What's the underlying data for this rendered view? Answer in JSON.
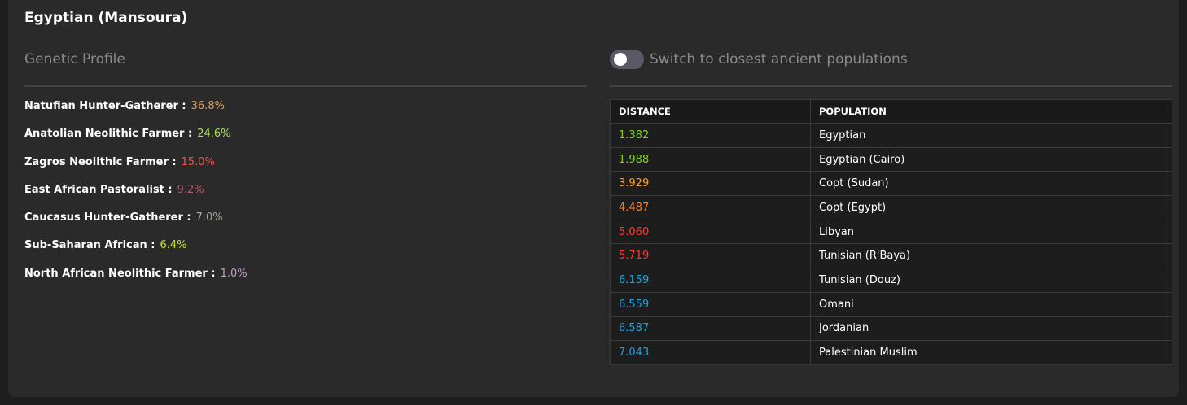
{
  "title": "Egyptian (Mansoura)",
  "genetic_profile": {
    "heading": "Genetic Profile",
    "items": [
      {
        "name": "Natufian Hunter-Gatherer :",
        "value": "36.8%",
        "color": "#d9a066"
      },
      {
        "name": "Anatolian Neolithic Farmer :",
        "value": "24.6%",
        "color": "#a5e05a"
      },
      {
        "name": "Zagros Neolithic Farmer :",
        "value": "15.0%",
        "color": "#ef5350"
      },
      {
        "name": "East African Pastoralist :",
        "value": "9.2%",
        "color": "#b5566c"
      },
      {
        "name": "Caucasus Hunter-Gatherer :",
        "value": "7.0%",
        "color": "#a8a89a"
      },
      {
        "name": "Sub-Saharan African :",
        "value": "6.4%",
        "color": "#c6e02a"
      },
      {
        "name": "North African Neolithic Farmer :",
        "value": "1.0%",
        "color": "#c49ac4"
      }
    ]
  },
  "toggle": {
    "label": "Switch to closest ancient populations",
    "on": false
  },
  "table": {
    "headers": {
      "distance": "DISTANCE",
      "population": "POPULATION"
    },
    "rows": [
      {
        "distance": "1.382",
        "population": "Egyptian",
        "color": "#7ed321"
      },
      {
        "distance": "1.988",
        "population": "Egyptian (Cairo)",
        "color": "#7ed321"
      },
      {
        "distance": "3.929",
        "population": "Copt (Sudan)",
        "color": "#ff9f1a"
      },
      {
        "distance": "4.487",
        "population": "Copt (Egypt)",
        "color": "#ff7a1a"
      },
      {
        "distance": "5.060",
        "population": "Libyan",
        "color": "#ff3b30"
      },
      {
        "distance": "5.719",
        "population": "Tunisian (R'Baya)",
        "color": "#ff3b30"
      },
      {
        "distance": "6.159",
        "population": "Tunisian (Douz)",
        "color": "#2a9fd6"
      },
      {
        "distance": "6.559",
        "population": "Omani",
        "color": "#2a9fd6"
      },
      {
        "distance": "6.587",
        "population": "Jordanian",
        "color": "#2a9fd6"
      },
      {
        "distance": "7.043",
        "population": "Palestinian Muslim",
        "color": "#2a9fd6"
      }
    ]
  }
}
